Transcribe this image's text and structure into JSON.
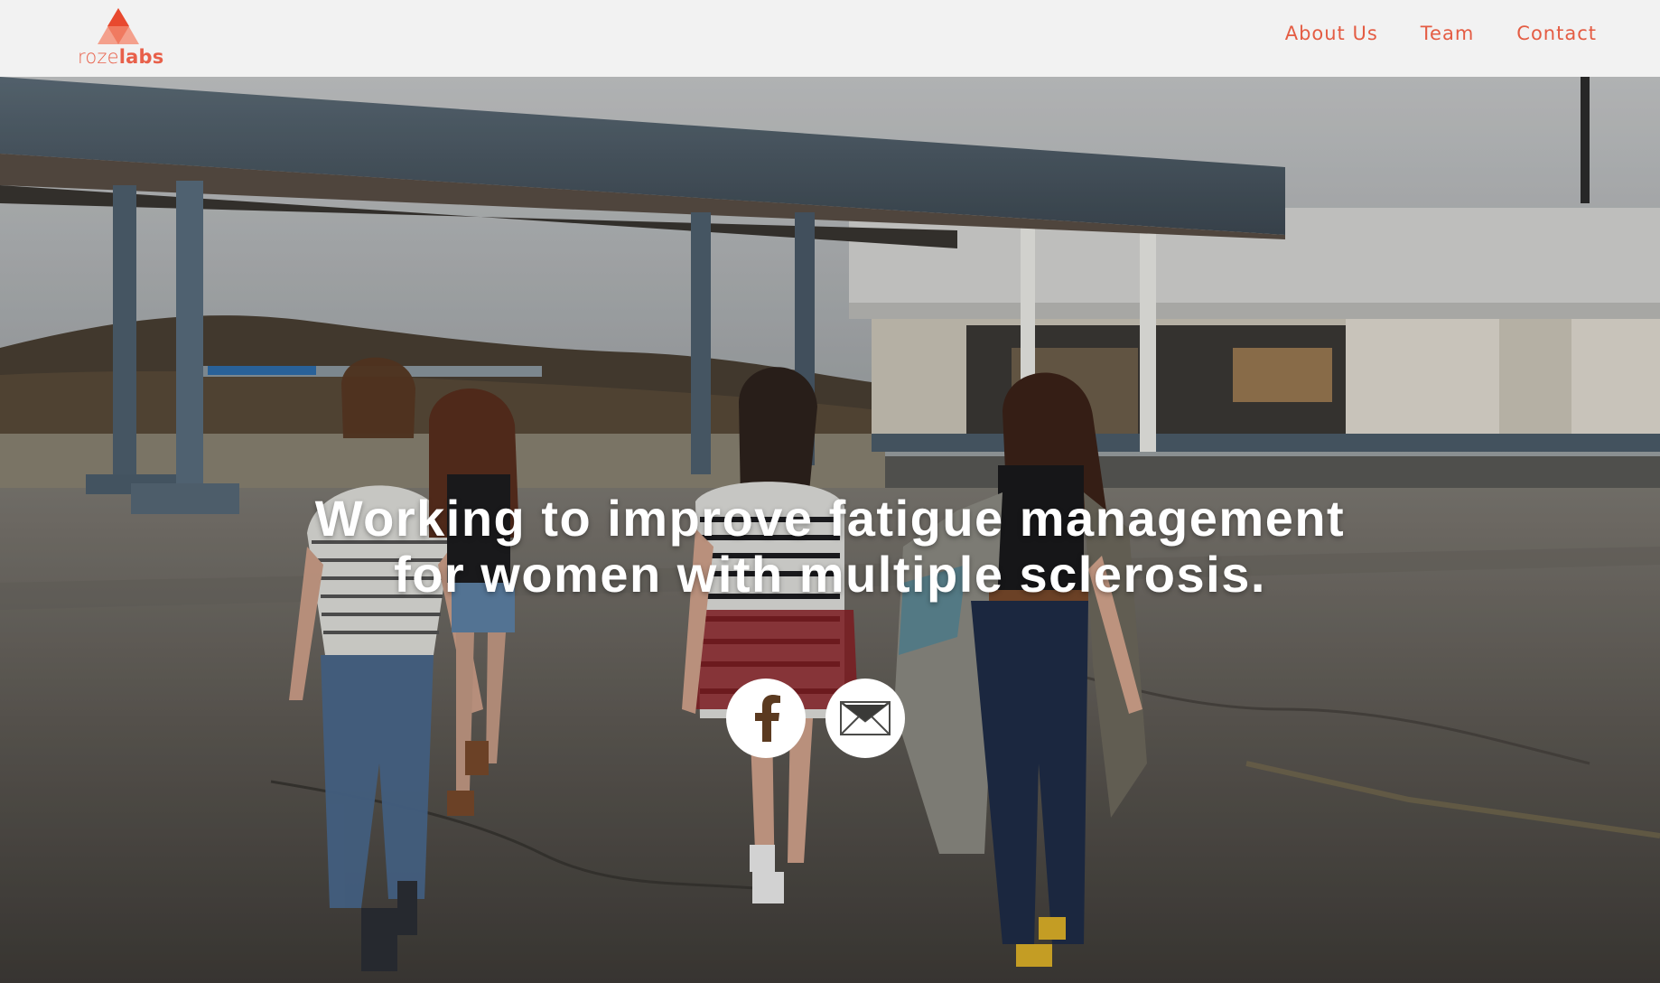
{
  "brand": {
    "name_light": "roze",
    "name_bold": "labs",
    "accent_color": "#e8604a"
  },
  "nav": {
    "items": [
      {
        "label": "About Us"
      },
      {
        "label": "Team"
      },
      {
        "label": "Contact"
      }
    ]
  },
  "hero": {
    "headline_line1": "Working to improve fatigue management",
    "headline_line2": "for women with multiple sclerosis.",
    "background": "photo of four women walking past an abandoned gas station",
    "social": [
      {
        "name": "facebook-icon"
      },
      {
        "name": "mail-icon"
      }
    ]
  }
}
